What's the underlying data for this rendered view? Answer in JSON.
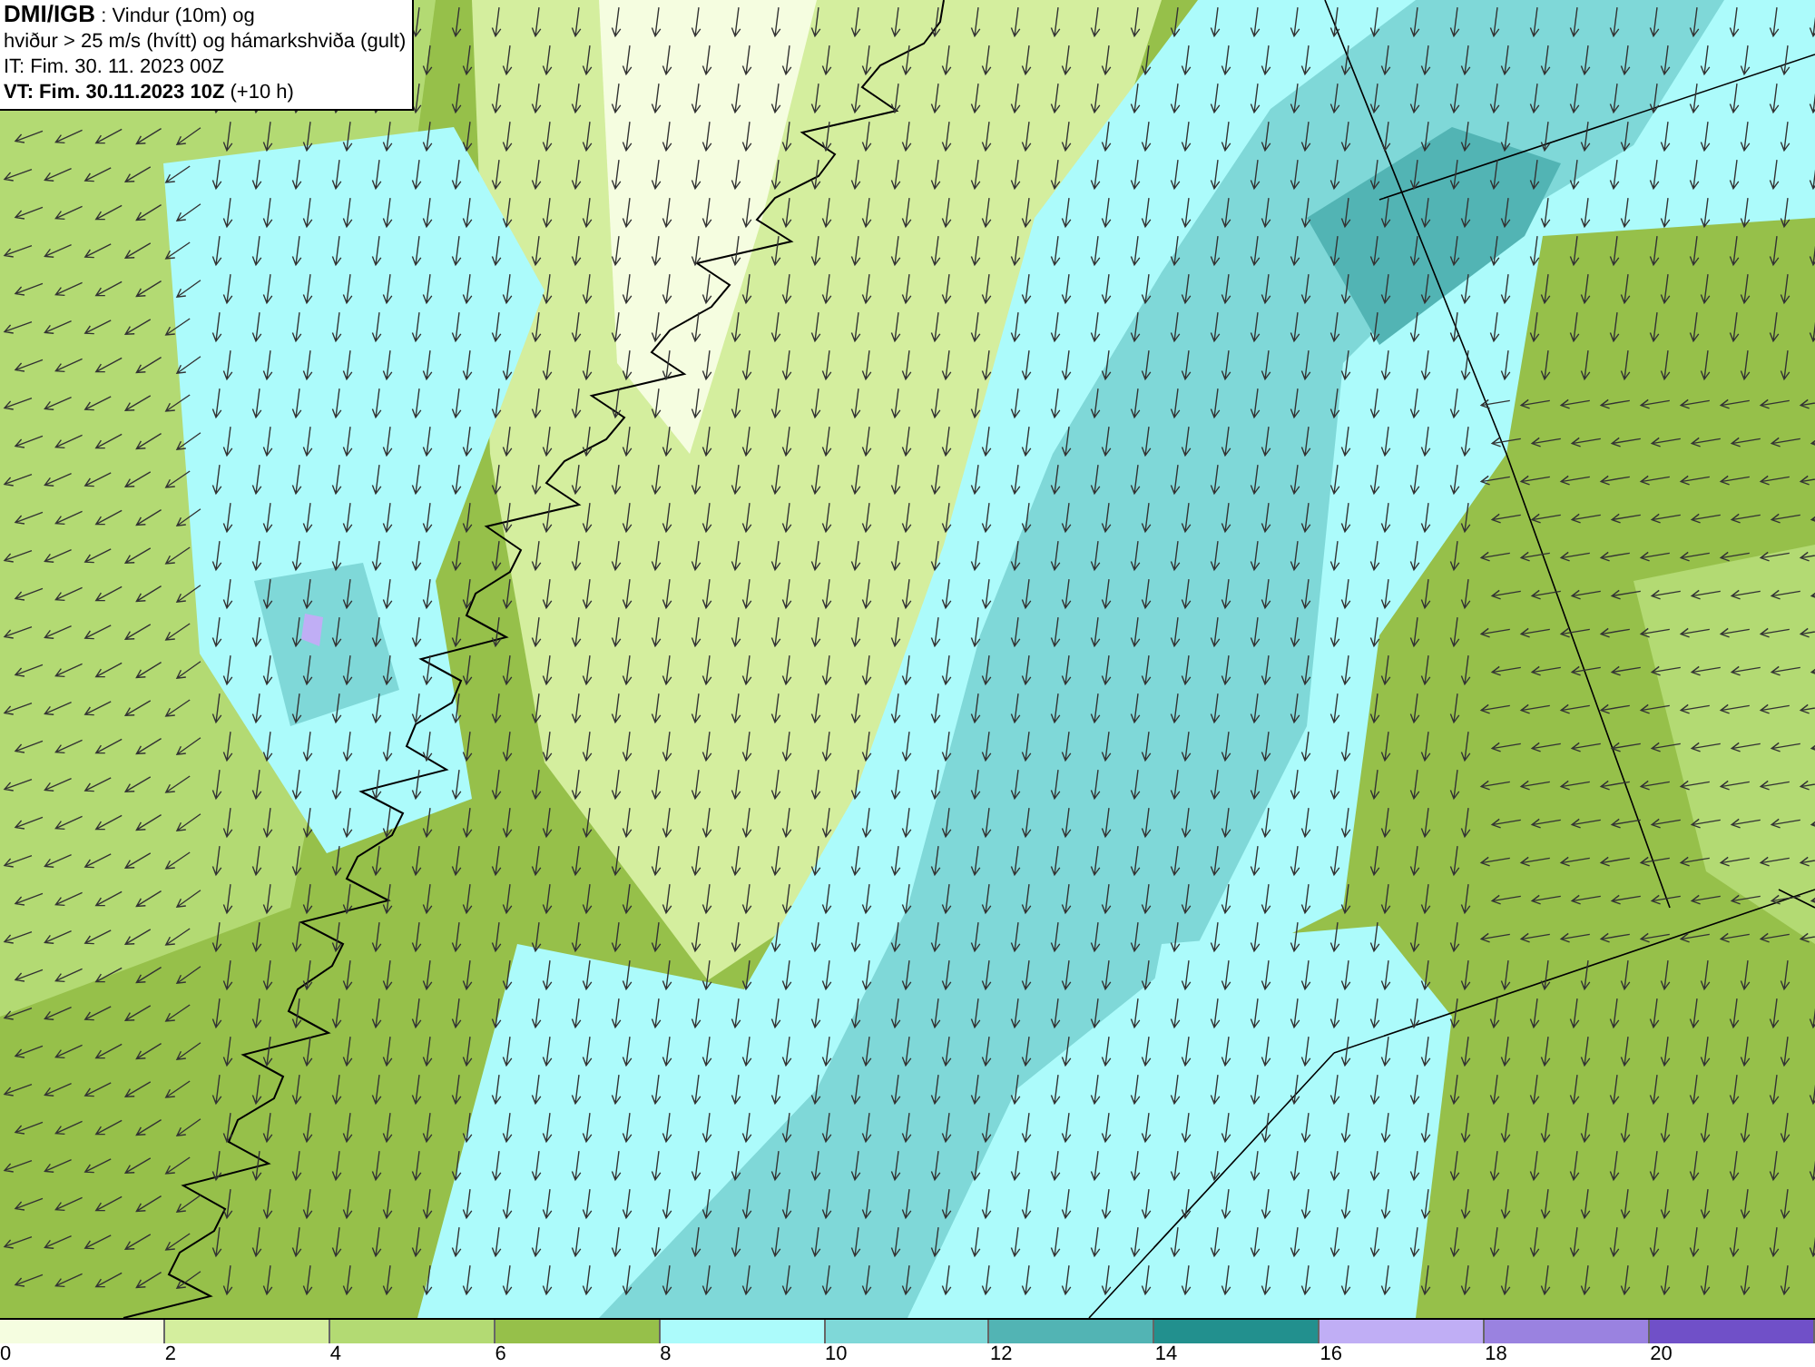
{
  "title_box": {
    "lines": [
      "**DMI/IGB** : Vindur (10m) og",
      "hviður > 25 m/s (hvítt) og hámarkshviða (gult)",
      "IT: Fim. 30. 11. 2023 00Z",
      "**VT: Fim. 30.11.2023 10Z** (+10 h)"
    ]
  },
  "legend": {
    "swatches": [
      {
        "color": "#f5fde0"
      },
      {
        "color": "#d4ee9e"
      },
      {
        "color": "#b3da73"
      },
      {
        "color": "#96c04a"
      },
      {
        "color": "#acfbfb"
      },
      {
        "color": "#7fd8d8"
      },
      {
        "color": "#52b4b4"
      },
      {
        "color": "#22908e"
      },
      {
        "color": "#c0aef5"
      },
      {
        "color": "#9a82e0"
      },
      {
        "color": "#7050c8"
      }
    ],
    "ticks": [
      "0",
      "2",
      "4",
      "6",
      "8",
      "10",
      "12",
      "14",
      "16",
      "18",
      "20"
    ]
  }
}
